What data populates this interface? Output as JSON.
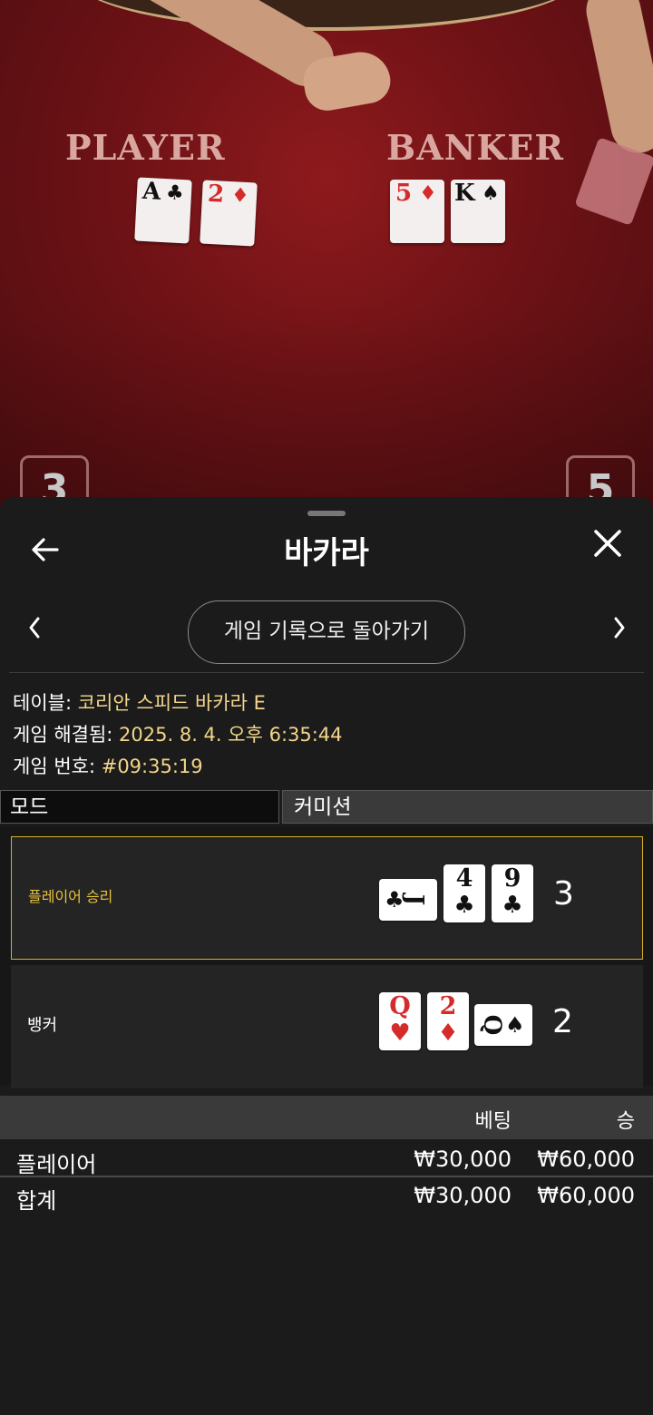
{
  "video": {
    "player_label": "PLAYER",
    "banker_label": "BANKER",
    "player_cards": [
      {
        "rank": "A",
        "suit": "♣",
        "color": "#111111"
      },
      {
        "rank": "2",
        "suit": "♦",
        "color": "#d52b2b"
      }
    ],
    "banker_cards": [
      {
        "rank": "5",
        "suit": "♦",
        "color": "#d52b2b"
      },
      {
        "rank": "K",
        "suit": "♠",
        "color": "#111111"
      }
    ],
    "player_score": "3",
    "banker_score": "5"
  },
  "header": {
    "title": "바카라",
    "back_icon": "arrow-left-icon",
    "close_icon": "close-icon"
  },
  "nav": {
    "prev_icon": "chevron-left-icon",
    "next_icon": "chevron-right-icon",
    "back_to_history_label": "게임 기록으로 돌아가기"
  },
  "info": {
    "table_label": "테이블:",
    "table_value": "코리안 스피드 바카라 E",
    "resolved_label": "게임 해결됨:",
    "resolved_value": "2025. 8. 4. 오후 6:35:44",
    "game_no_label": "게임 번호:",
    "game_no_value": "#09:35:19"
  },
  "mode": {
    "label": "모드",
    "value": "커미션"
  },
  "results": {
    "player": {
      "label": "플레이어 승리",
      "score": "3",
      "cards": [
        {
          "rank": "J",
          "suit": "♣",
          "orientation": "sideways"
        },
        {
          "rank": "4",
          "suit": "♣",
          "orientation": "upright"
        },
        {
          "rank": "9",
          "suit": "♣",
          "orientation": "upright"
        }
      ]
    },
    "banker": {
      "label": "뱅커",
      "score": "2",
      "cards": [
        {
          "rank": "Q",
          "suit": "♥",
          "orientation": "upright"
        },
        {
          "rank": "2",
          "suit": "♦",
          "orientation": "upright"
        },
        {
          "rank": "Q",
          "suit": "♠",
          "orientation": "sideways"
        }
      ]
    }
  },
  "bets": {
    "col_bet": "베팅",
    "col_win": "승",
    "rows": [
      {
        "name": "플레이어",
        "bet": "₩30,000",
        "win": "₩60,000"
      }
    ],
    "total": {
      "name": "합계",
      "bet": "₩30,000",
      "win": "₩60,000"
    }
  },
  "colors": {
    "win_highlight": "#d8b02a",
    "info_value": "#f3d68a",
    "felt": "#7a1418"
  }
}
